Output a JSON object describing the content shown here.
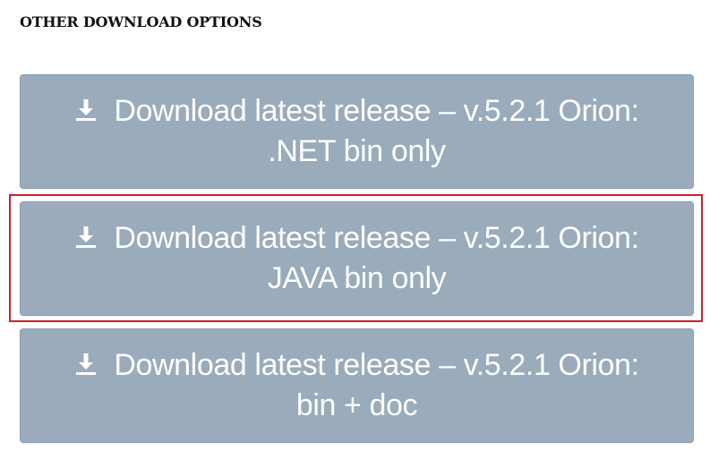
{
  "section": {
    "heading": "OTHER DOWNLOAD OPTIONS"
  },
  "buttons": [
    {
      "line1": "Download latest release – v.5.2.1 Orion:",
      "line2": ".NET bin only",
      "icon": "download-icon"
    },
    {
      "line1": "Download latest release – v.5.2.1 Orion:",
      "line2": "JAVA bin only",
      "icon": "download-icon",
      "highlighted": true
    },
    {
      "line1": "Download latest release – v.5.2.1 Orion:",
      "line2": "bin + doc",
      "icon": "download-icon"
    }
  ],
  "colors": {
    "button_bg": "#9aabbb",
    "button_text": "#ffffff",
    "highlight": "#d0202a",
    "heading": "#111111"
  }
}
